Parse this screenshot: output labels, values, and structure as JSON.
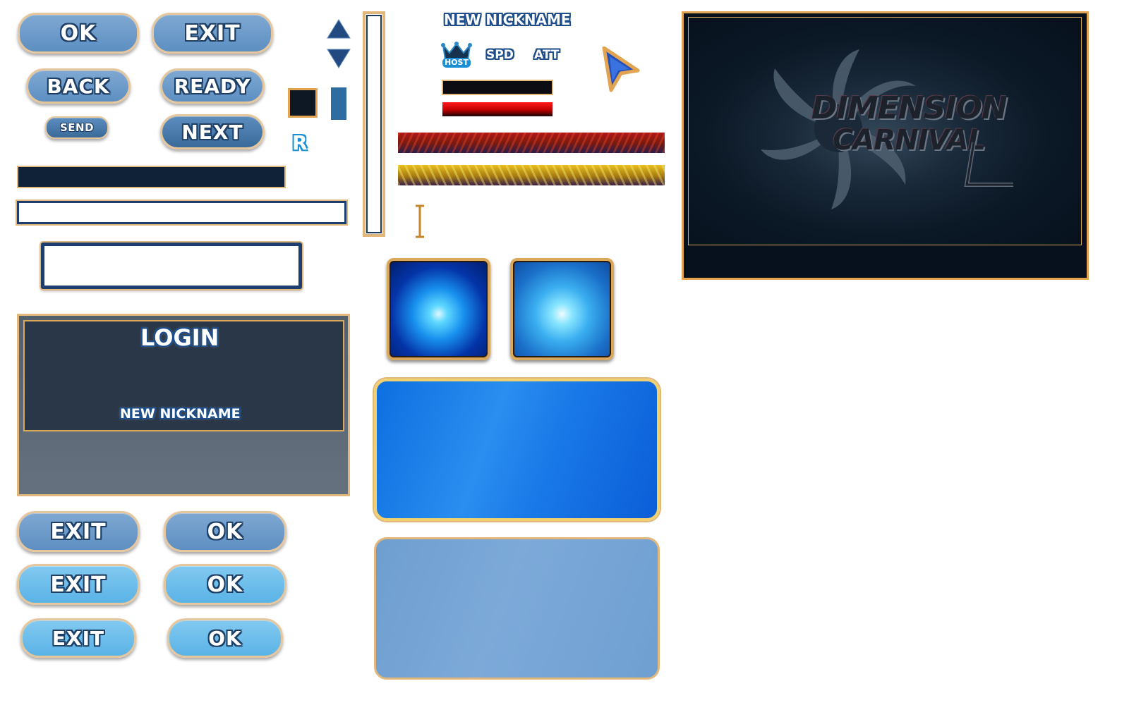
{
  "buttons": {
    "ok_top": "OK",
    "exit_top": "EXIT",
    "back": "BACK",
    "ready": "READY",
    "send": "SEND",
    "next": "NEXT",
    "exit_normal": "EXIT",
    "ok_normal": "OK",
    "exit_hover": "EXIT",
    "ok_hover": "OK",
    "exit_pressed": "EXIT",
    "ok_pressed": "OK"
  },
  "header": {
    "nickname_label": "NEW NICKNAME",
    "host_label": "HOST",
    "spd_label": "SPD",
    "att_label": "ATT"
  },
  "r_label": "R",
  "login_panel": {
    "title": "LOGIN",
    "nickname_label": "NEW NICKNAME"
  },
  "logo": {
    "line1": "DIMENSION",
    "line2": "CARNIVAL"
  },
  "colors": {
    "gold_border": "#e2b77c",
    "button_blue": "#5d8fc2",
    "button_light": "#5ab3e6",
    "navy": "#0d1d30",
    "hp_red": "#c8000a"
  }
}
